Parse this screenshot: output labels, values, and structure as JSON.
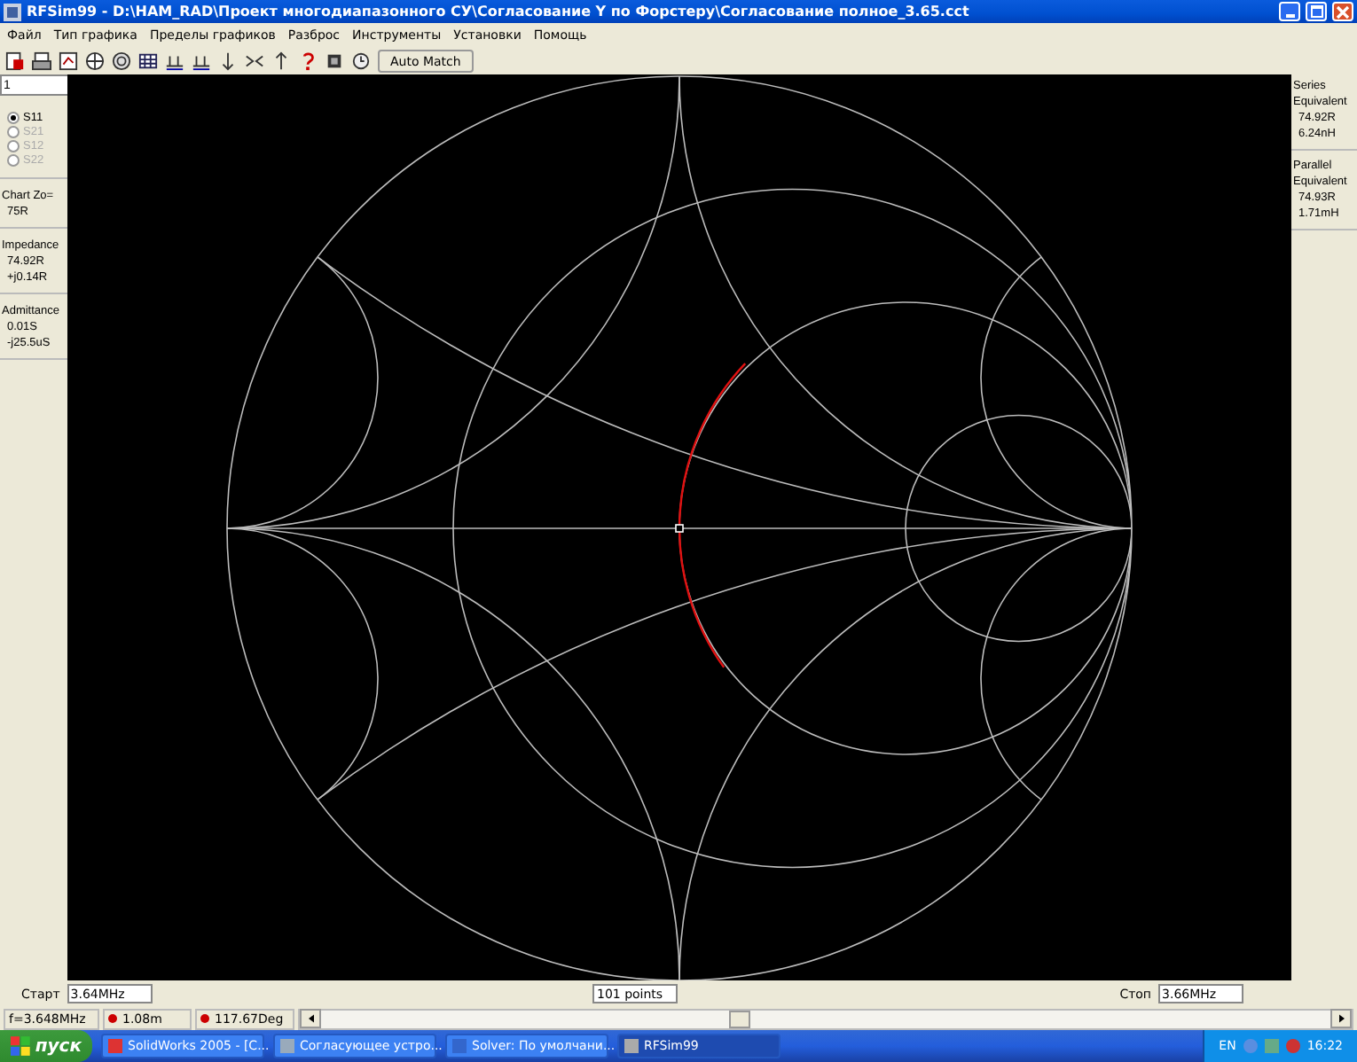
{
  "window": {
    "title": "RFSim99 - D:\\HAM_RAD\\Проект многодиапазонного СУ\\Согласование Y по Форстеру\\Согласование полное_3.65.cct"
  },
  "menu": [
    "Файл",
    "Тип графика",
    "Пределы графиков",
    "Разброс",
    "Инструменты",
    "Установки",
    "Помощь"
  ],
  "toolbar": {
    "button": "Auto Match"
  },
  "left_panel": {
    "field_value": "1",
    "ports": [
      {
        "label": "S11",
        "selected": true,
        "disabled": false
      },
      {
        "label": "S21",
        "selected": false,
        "disabled": true
      },
      {
        "label": "S12",
        "selected": false,
        "disabled": true
      },
      {
        "label": "S22",
        "selected": false,
        "disabled": true
      }
    ],
    "chart_zo": {
      "label": "Chart Zo=",
      "value": "75R"
    },
    "impedance": {
      "label": "Impedance",
      "values": [
        "74.92R",
        "+j0.14R"
      ]
    },
    "admittance": {
      "label": "Admittance",
      "values": [
        "0.01S",
        "-j25.5uS"
      ]
    }
  },
  "right_panel": {
    "series": {
      "label": "Series Equivalent",
      "values": [
        "74.92R",
        "6.24nH"
      ]
    },
    "parallel": {
      "label": "Parallel Equivalent",
      "values": [
        "74.93R",
        "1.71mH"
      ]
    }
  },
  "sweep": {
    "start": {
      "label": "Старт",
      "value": "3.64MHz"
    },
    "points": "101 points",
    "stop": {
      "label": "Стоп",
      "value": "3.66MHz"
    }
  },
  "status_bar": [
    "f=3.648MHz",
    "1.08m",
    "117.67Deg"
  ],
  "taskbar": {
    "start": "пуск",
    "tasks": [
      {
        "label": "SolidWorks 2005 - [C...",
        "selected": false
      },
      {
        "label": "Согласующее устро...",
        "selected": false
      },
      {
        "label": "Solver: По умолчани...",
        "selected": false
      },
      {
        "label": "RFSim99",
        "selected": true
      }
    ],
    "language": "EN",
    "clock": "16:22"
  }
}
